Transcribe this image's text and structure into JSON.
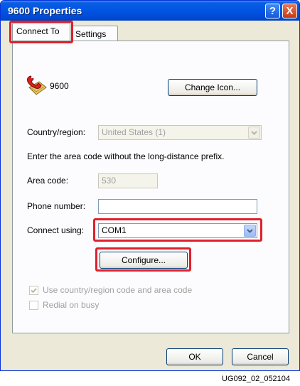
{
  "window": {
    "title": "9600 Properties"
  },
  "titlebar_buttons": {
    "help": "?",
    "close": "X"
  },
  "tabs": [
    {
      "label": "Connect To",
      "active": true
    },
    {
      "label": "Settings",
      "active": false
    }
  ],
  "connection": {
    "icon": "phone-icon",
    "name": "9600",
    "change_icon_button": "Change Icon..."
  },
  "country": {
    "label": "Country/region:",
    "value": "United States (1)"
  },
  "instructions": "Enter the area code without the long-distance prefix.",
  "area_code": {
    "label": "Area code:",
    "value": "530"
  },
  "phone_number": {
    "label": "Phone number:",
    "value": ""
  },
  "connect_using": {
    "label": "Connect using:",
    "value": "COM1"
  },
  "configure_button": "Configure...",
  "checkboxes": [
    {
      "label": "Use country/region code and area code",
      "checked": true,
      "enabled": false
    },
    {
      "label": "Redial on busy",
      "checked": false,
      "enabled": false
    }
  ],
  "footer": {
    "ok": "OK",
    "cancel": "Cancel"
  },
  "caption": "UG092_02_052104",
  "colors": {
    "titlebar": "#0054E3",
    "highlight": "#E0202C",
    "face": "#ECE9D8"
  }
}
